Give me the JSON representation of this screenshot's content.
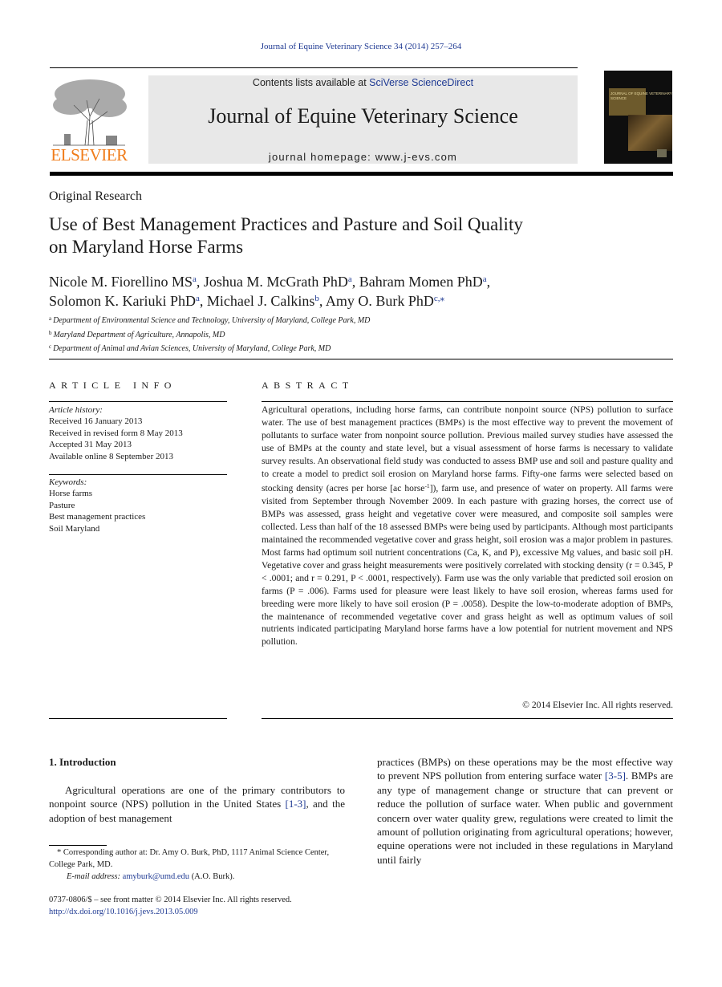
{
  "header": {
    "citation": "Journal of Equine Veterinary Science 34 (2014) 257–264",
    "publisher_logo_text": "ELSEVIER",
    "contents_prefix": "Contents lists available at ",
    "contents_link": "SciVerse ScienceDirect",
    "journal_title": "Journal of Equine Veterinary Science",
    "homepage": "journal homepage: www.j-evs.com",
    "cover_text": "JOURNAL OF EQUINE VETERINARY SCIENCE"
  },
  "article": {
    "section": "Original Research",
    "title_line1": "Use of Best Management Practices and Pasture and Soil Quality",
    "title_line2": "on Maryland Horse Farms",
    "authors": [
      {
        "name": "Nicole M. Fiorellino MS",
        "sup": "a",
        "sep": ", "
      },
      {
        "name": "Joshua M. McGrath PhD",
        "sup": "a",
        "sep": ", "
      },
      {
        "name": "Bahram Momen PhD",
        "sup": "a",
        "sep": ","
      },
      {
        "name": "Solomon K. Kariuki PhD",
        "sup": "a",
        "sep": ", "
      },
      {
        "name": "Michael J. Calkins",
        "sup": "b",
        "sep": ", "
      },
      {
        "name": "Amy O. Burk PhD",
        "sup": "c,⁎",
        "sep": ""
      }
    ],
    "affiliations": [
      {
        "sup": "a",
        "text": "Department of Environmental Science and Technology, University of Maryland, College Park, MD"
      },
      {
        "sup": "b",
        "text": "Maryland Department of Agriculture, Annapolis, MD"
      },
      {
        "sup": "c",
        "text": "Department of Animal and Avian Sciences, University of Maryland, College Park, MD"
      }
    ]
  },
  "article_info": {
    "heading": "ARTICLE INFO",
    "history_label": "Article history:",
    "history": [
      "Received 16 January 2013",
      "Received in revised form 8 May 2013",
      "Accepted 31 May 2013",
      "Available online 8 September 2013"
    ],
    "keywords_label": "Keywords:",
    "keywords": [
      "Horse farms",
      "Pasture",
      "Best management practices",
      "Soil Maryland"
    ]
  },
  "abstract": {
    "heading": "ABSTRACT",
    "text_part1": "Agricultural operations, including horse farms, can contribute nonpoint source (NPS) pollution to surface water. The use of best management practices (BMPs) is the most effective way to prevent the movement of pollutants to surface water from nonpoint source pollution. Previous mailed survey studies have assessed the use of BMPs at the county and state level, but a visual assessment of horse farms is necessary to validate survey results. An observational field study was conducted to assess BMP use and soil and pasture quality and to create a model to predict soil erosion on Maryland horse farms. Fifty-one farms were selected based on stocking density (acres per horse [ac horse",
    "text_sup": "-1",
    "text_part2": "]), farm use, and presence of water on property. All farms were visited from September through November 2009. In each pasture with grazing horses, the correct use of BMPs was assessed, grass height and vegetative cover were measured, and composite soil samples were collected. Less than half of the 18 assessed BMPs were being used by participants. Although most participants maintained the recommended vegetative cover and grass height, soil erosion was a major problem in pastures. Most farms had optimum soil nutrient concentrations (Ca, K, and P), excessive Mg values, and basic soil pH. Vegetative cover and grass height measurements were positively correlated with stocking density (r = 0.345, P < .0001; and r = 0.291, P < .0001, respectively). Farm use was the only variable that predicted soil erosion on farms (P = .006). Farms used for pleasure were least likely to have soil erosion, whereas farms used for breeding were more likely to have soil erosion (P = .0058). Despite the low-to-moderate adoption of BMPs, the maintenance of recommended vegetative cover and grass height as well as optimum values of soil nutrients indicated participating Maryland horse farms have a low potential for nutrient movement and NPS pollution.",
    "copyright": "© 2014 Elsevier Inc. All rights reserved."
  },
  "introduction": {
    "heading": "1.  Introduction",
    "left_part1": "Agricultural operations are one of the primary contributors to nonpoint source (NPS) pollution in the United States ",
    "left_ref": "[1-3]",
    "left_part2": ", and the adoption of best management",
    "right_part1": "practices (BMPs) on these operations may be the most effective way to prevent NPS pollution from entering surface water ",
    "right_ref": "[3-5]",
    "right_part2": ". BMPs are any type of management change or structure that can prevent or reduce the pollution of surface water. When public and government concern over water quality grew, regulations were created to limit the amount of pollution originating from agricultural operations; however, equine operations were not included in these regulations in Maryland until fairly"
  },
  "footnotes": {
    "corresponding": "* Corresponding author at: Dr. Amy O. Burk, PhD, 1117 Animal Science Center, College Park, MD.",
    "email_label": "E-mail address:",
    "email": "amyburk@umd.edu",
    "email_suffix": " (A.O. Burk).",
    "front_matter": "0737-0806/$ – see front matter © 2014 Elsevier Inc. All rights reserved.",
    "doi": "http://dx.doi.org/10.1016/j.jevs.2013.05.009"
  }
}
